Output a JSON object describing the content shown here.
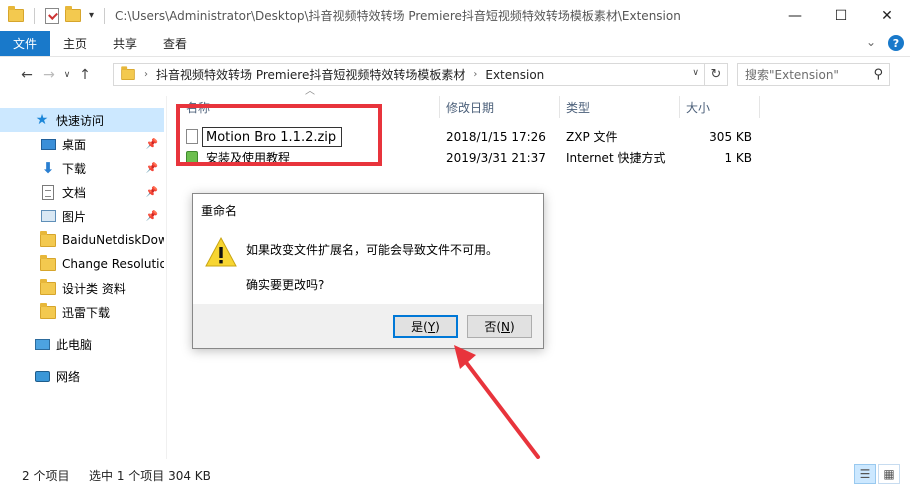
{
  "window": {
    "title": "C:\\Users\\Administrator\\Desktop\\抖音视频特效转场 Premiere抖音短视频特效转场模板素材\\Extension",
    "minimize": "—",
    "maximize": "☐",
    "close": "✕"
  },
  "ribbon": {
    "tabs": [
      "文件",
      "主页",
      "共享",
      "查看"
    ],
    "collapse": "⌄",
    "help": "?"
  },
  "address": {
    "crumbs": [
      "抖音视频特效转场 Premiere抖音短视频特效转场模板素材",
      "Extension"
    ],
    "search_placeholder": "搜索\"Extension\""
  },
  "sidebar": {
    "items": [
      {
        "label": "快速访问",
        "icon": "star-icon",
        "pinned": false
      },
      {
        "label": "桌面",
        "icon": "desktop-icon",
        "pinned": true
      },
      {
        "label": "下载",
        "icon": "download-icon",
        "pinned": true
      },
      {
        "label": "文档",
        "icon": "document-icon",
        "pinned": true
      },
      {
        "label": "图片",
        "icon": "pictures-icon",
        "pinned": true
      },
      {
        "label": "BaiduNetdiskDow",
        "icon": "folder-icon",
        "pinned": false
      },
      {
        "label": "Change Resolutio",
        "icon": "folder-icon",
        "pinned": false
      },
      {
        "label": "设计类 资料",
        "icon": "folder-icon",
        "pinned": false
      },
      {
        "label": "迅雷下载",
        "icon": "folder-icon",
        "pinned": false
      },
      {
        "label": "此电脑",
        "icon": "pc-icon",
        "pinned": false
      },
      {
        "label": "网络",
        "icon": "network-icon",
        "pinned": false
      }
    ]
  },
  "columns": {
    "name": "名称",
    "modified": "修改日期",
    "type": "类型",
    "size": "大小"
  },
  "files": [
    {
      "name": "Motion Bro 1.1.2.zip",
      "modified": "2018/1/15 17:26",
      "type": "ZXP 文件",
      "size": "305 KB"
    },
    {
      "name": "安装及使用教程",
      "modified": "2019/3/31 21:37",
      "type": "Internet 快捷方式",
      "size": "1 KB"
    }
  ],
  "dialog": {
    "title": "重命名",
    "message": "如果改变文件扩展名，可能会导致文件不可用。",
    "question": "确实要更改吗?",
    "yes_label": "是(",
    "yes_key": "Y",
    "no_label": "否(",
    "no_key": "N",
    "close_paren": ")"
  },
  "status": {
    "item_count": "2 个项目",
    "selected": "选中 1 个项目  304 KB"
  },
  "colors": {
    "accent": "#1979ca",
    "selection": "#cce8ff",
    "highlight_red": "#e8343c"
  }
}
